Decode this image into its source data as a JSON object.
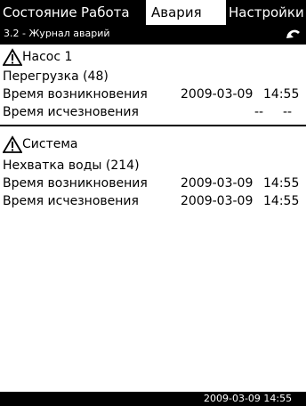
{
  "tabs": [
    {
      "label": "Состояние"
    },
    {
      "label": "Работа"
    },
    {
      "label": "Авария"
    },
    {
      "label": "Настройки"
    }
  ],
  "subheader": {
    "title": "3.2 - Журнал аварий",
    "back_icon": "back-arrow-icon"
  },
  "alarms": [
    {
      "icon": "warning-triangle-icon",
      "source": "Насос 1",
      "alarm": "Перегрузка (48)",
      "appeared_label": "Время возникновения",
      "appeared_date": "2009-03-09",
      "appeared_time": "14:55",
      "cleared_label": "Время исчезновения",
      "cleared_date": "--",
      "cleared_time": "--"
    },
    {
      "icon": "warning-triangle-icon",
      "source": "Система",
      "alarm": "Нехватка воды (214)",
      "appeared_label": "Время возникновения",
      "appeared_date": "2009-03-09",
      "appeared_time": "14:55",
      "cleared_label": "Время исчезновения",
      "cleared_date": "2009-03-09",
      "cleared_time": "14:55"
    }
  ],
  "footer": {
    "datetime": "2009-03-09 14:55"
  },
  "colors": {
    "bar": "#000000",
    "background": "#ffffff"
  }
}
